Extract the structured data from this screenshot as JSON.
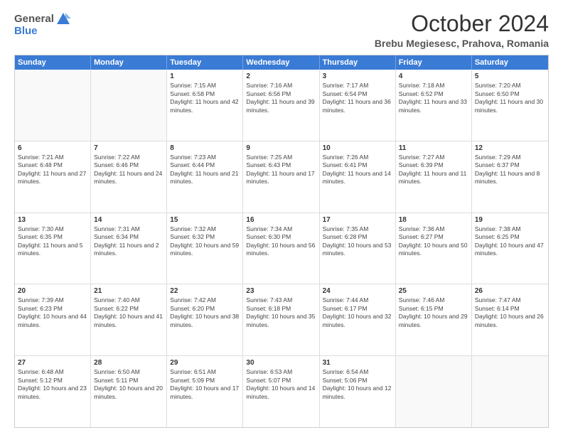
{
  "header": {
    "logo_general": "General",
    "logo_blue": "Blue",
    "month_title": "October 2024",
    "location": "Brebu Megiesesc, Prahova, Romania"
  },
  "days_of_week": [
    "Sunday",
    "Monday",
    "Tuesday",
    "Wednesday",
    "Thursday",
    "Friday",
    "Saturday"
  ],
  "weeks": [
    [
      {
        "day": "",
        "empty": true
      },
      {
        "day": "",
        "empty": true
      },
      {
        "day": "1",
        "sunrise": "7:15 AM",
        "sunset": "6:58 PM",
        "daylight": "11 hours and 42 minutes."
      },
      {
        "day": "2",
        "sunrise": "7:16 AM",
        "sunset": "6:56 PM",
        "daylight": "11 hours and 39 minutes."
      },
      {
        "day": "3",
        "sunrise": "7:17 AM",
        "sunset": "6:54 PM",
        "daylight": "11 hours and 36 minutes."
      },
      {
        "day": "4",
        "sunrise": "7:18 AM",
        "sunset": "6:52 PM",
        "daylight": "11 hours and 33 minutes."
      },
      {
        "day": "5",
        "sunrise": "7:20 AM",
        "sunset": "6:50 PM",
        "daylight": "11 hours and 30 minutes."
      }
    ],
    [
      {
        "day": "6",
        "sunrise": "7:21 AM",
        "sunset": "6:48 PM",
        "daylight": "11 hours and 27 minutes."
      },
      {
        "day": "7",
        "sunrise": "7:22 AM",
        "sunset": "6:46 PM",
        "daylight": "11 hours and 24 minutes."
      },
      {
        "day": "8",
        "sunrise": "7:23 AM",
        "sunset": "6:44 PM",
        "daylight": "11 hours and 21 minutes."
      },
      {
        "day": "9",
        "sunrise": "7:25 AM",
        "sunset": "6:43 PM",
        "daylight": "11 hours and 17 minutes."
      },
      {
        "day": "10",
        "sunrise": "7:26 AM",
        "sunset": "6:41 PM",
        "daylight": "11 hours and 14 minutes."
      },
      {
        "day": "11",
        "sunrise": "7:27 AM",
        "sunset": "6:39 PM",
        "daylight": "11 hours and 11 minutes."
      },
      {
        "day": "12",
        "sunrise": "7:29 AM",
        "sunset": "6:37 PM",
        "daylight": "11 hours and 8 minutes."
      }
    ],
    [
      {
        "day": "13",
        "sunrise": "7:30 AM",
        "sunset": "6:35 PM",
        "daylight": "11 hours and 5 minutes."
      },
      {
        "day": "14",
        "sunrise": "7:31 AM",
        "sunset": "6:34 PM",
        "daylight": "11 hours and 2 minutes."
      },
      {
        "day": "15",
        "sunrise": "7:32 AM",
        "sunset": "6:32 PM",
        "daylight": "10 hours and 59 minutes."
      },
      {
        "day": "16",
        "sunrise": "7:34 AM",
        "sunset": "6:30 PM",
        "daylight": "10 hours and 56 minutes."
      },
      {
        "day": "17",
        "sunrise": "7:35 AM",
        "sunset": "6:28 PM",
        "daylight": "10 hours and 53 minutes."
      },
      {
        "day": "18",
        "sunrise": "7:36 AM",
        "sunset": "6:27 PM",
        "daylight": "10 hours and 50 minutes."
      },
      {
        "day": "19",
        "sunrise": "7:38 AM",
        "sunset": "6:25 PM",
        "daylight": "10 hours and 47 minutes."
      }
    ],
    [
      {
        "day": "20",
        "sunrise": "7:39 AM",
        "sunset": "6:23 PM",
        "daylight": "10 hours and 44 minutes."
      },
      {
        "day": "21",
        "sunrise": "7:40 AM",
        "sunset": "6:22 PM",
        "daylight": "10 hours and 41 minutes."
      },
      {
        "day": "22",
        "sunrise": "7:42 AM",
        "sunset": "6:20 PM",
        "daylight": "10 hours and 38 minutes."
      },
      {
        "day": "23",
        "sunrise": "7:43 AM",
        "sunset": "6:18 PM",
        "daylight": "10 hours and 35 minutes."
      },
      {
        "day": "24",
        "sunrise": "7:44 AM",
        "sunset": "6:17 PM",
        "daylight": "10 hours and 32 minutes."
      },
      {
        "day": "25",
        "sunrise": "7:46 AM",
        "sunset": "6:15 PM",
        "daylight": "10 hours and 29 minutes."
      },
      {
        "day": "26",
        "sunrise": "7:47 AM",
        "sunset": "6:14 PM",
        "daylight": "10 hours and 26 minutes."
      }
    ],
    [
      {
        "day": "27",
        "sunrise": "6:48 AM",
        "sunset": "5:12 PM",
        "daylight": "10 hours and 23 minutes."
      },
      {
        "day": "28",
        "sunrise": "6:50 AM",
        "sunset": "5:11 PM",
        "daylight": "10 hours and 20 minutes."
      },
      {
        "day": "29",
        "sunrise": "6:51 AM",
        "sunset": "5:09 PM",
        "daylight": "10 hours and 17 minutes."
      },
      {
        "day": "30",
        "sunrise": "6:53 AM",
        "sunset": "5:07 PM",
        "daylight": "10 hours and 14 minutes."
      },
      {
        "day": "31",
        "sunrise": "6:54 AM",
        "sunset": "5:06 PM",
        "daylight": "10 hours and 12 minutes."
      },
      {
        "day": "",
        "empty": true
      },
      {
        "day": "",
        "empty": true
      }
    ]
  ]
}
